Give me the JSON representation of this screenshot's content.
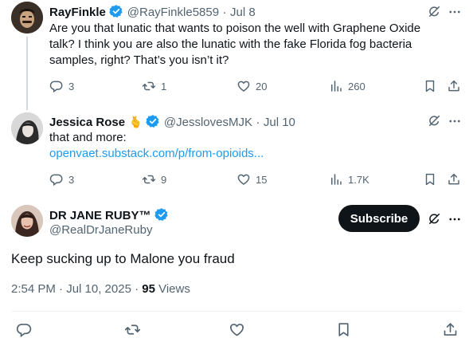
{
  "tweets": [
    {
      "display_name": "RayFinkle",
      "handle": "@RayFinkle5859",
      "sep": "·",
      "date": "Jul 8",
      "text_lines": [
        "Are you that lunatic that wants to poison the well with Graphene Oxide",
        "talk? I think you are also the lunatic with the fake Florida fog bacteria",
        "samples, right? That’s you isn’t it?"
      ],
      "reply_count": "3",
      "retweet_count": "1",
      "like_count": "20",
      "view_count": "260"
    },
    {
      "display_name": "Jessica Rose",
      "name_emoji": "🫰",
      "handle": "@JesslovesMJK",
      "sep": "·",
      "date": "Jul 10",
      "text": "that and more:",
      "link": "openvaet.substack.com/p/from-opioids...",
      "reply_count": "3",
      "retweet_count": "9",
      "like_count": "15",
      "view_count": "1.7K"
    }
  ],
  "main_tweet": {
    "display_name": "DR JANE RUBY™",
    "handle": "@RealDrJaneRuby",
    "subscribe_label": "Subscribe",
    "text": "Keep sucking up to Malone you fraud",
    "timestamp": "2:54 PM · Jul 10, 2025 · ",
    "views_count": "95",
    "views_label": " Views"
  },
  "colors": {
    "verified": "#1d9bf0",
    "link": "#1d9bf0",
    "muted": "#536471",
    "thread_line": "#cfd9de"
  },
  "icons": [
    "reply-icon",
    "retweet-icon",
    "like-icon",
    "views-icon",
    "bookmark-icon",
    "share-icon",
    "grok-icon",
    "more-icon",
    "verified-icon"
  ]
}
